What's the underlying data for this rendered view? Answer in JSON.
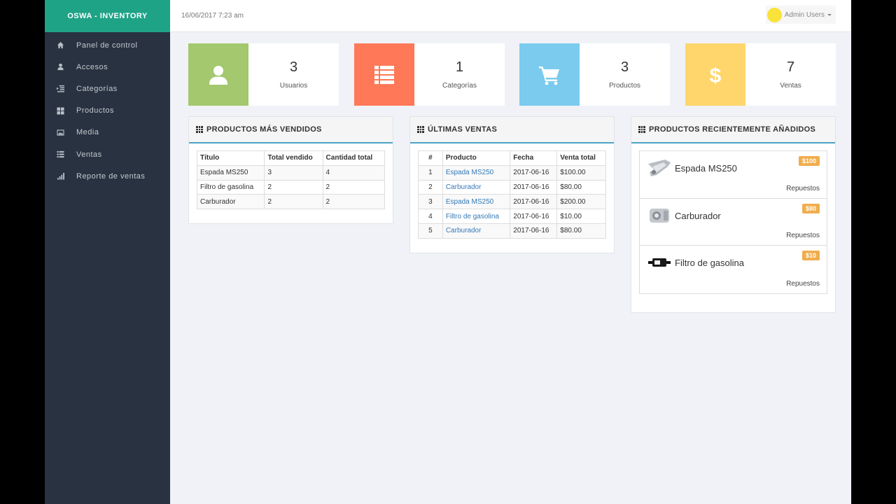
{
  "brand": "OSWA - INVENTORY",
  "header": {
    "datetime": "16/06/2017 7:23 am",
    "user_name": "Admin Users"
  },
  "sidebar": {
    "items": [
      {
        "label": "Panel de control",
        "icon": "home-icon"
      },
      {
        "label": "Accesos",
        "icon": "user-icon"
      },
      {
        "label": "Categorías",
        "icon": "indent-icon"
      },
      {
        "label": "Productos",
        "icon": "th-large-icon"
      },
      {
        "label": "Media",
        "icon": "picture-icon"
      },
      {
        "label": "Ventas",
        "icon": "list-icon"
      },
      {
        "label": "Reporte de ventas",
        "icon": "signal-icon"
      }
    ]
  },
  "stats": [
    {
      "value": "3",
      "label": "Usuarios",
      "color": "#a3c86d",
      "icon": "user-icon"
    },
    {
      "value": "1",
      "label": "Categorías",
      "color": "#ff7857",
      "icon": "list-icon"
    },
    {
      "value": "3",
      "label": "Productos",
      "color": "#7acbee",
      "icon": "cart-icon"
    },
    {
      "value": "7",
      "label": "Ventas",
      "color": "#ffd66b",
      "icon": "dollar-icon"
    }
  ],
  "top_products": {
    "title": "PRODUCTOS MÁS VENDIDOS",
    "columns": [
      "Título",
      "Total vendido",
      "Cantidad total"
    ],
    "rows": [
      [
        "Espada MS250",
        "3",
        "4"
      ],
      [
        "Filtro de gasolina",
        "2",
        "2"
      ],
      [
        "Carburador",
        "2",
        "2"
      ]
    ]
  },
  "latest_sales": {
    "title": "ÚLTIMAS VENTAS",
    "columns": [
      "#",
      "Producto",
      "Fecha",
      "Venta total"
    ],
    "rows": [
      [
        "1",
        "Espada MS250",
        "2017-06-16",
        "$100.00"
      ],
      [
        "2",
        "Carburador",
        "2017-06-16",
        "$80.00"
      ],
      [
        "3",
        "Espada MS250",
        "2017-06-16",
        "$200.00"
      ],
      [
        "4",
        "Filtro de gasolina",
        "2017-06-16",
        "$10.00"
      ],
      [
        "5",
        "Carburador",
        "2017-06-16",
        "$80.00"
      ]
    ]
  },
  "recent_products": {
    "title": "PRODUCTOS RECIENTEMENTE AÑADIDOS",
    "items": [
      {
        "name": "Espada MS250",
        "price": "$100",
        "category": "Repuestos"
      },
      {
        "name": "Carburador",
        "price": "$80",
        "category": "Repuestos"
      },
      {
        "name": "Filtro de gasolina",
        "price": "$10",
        "category": "Repuestos"
      }
    ]
  }
}
